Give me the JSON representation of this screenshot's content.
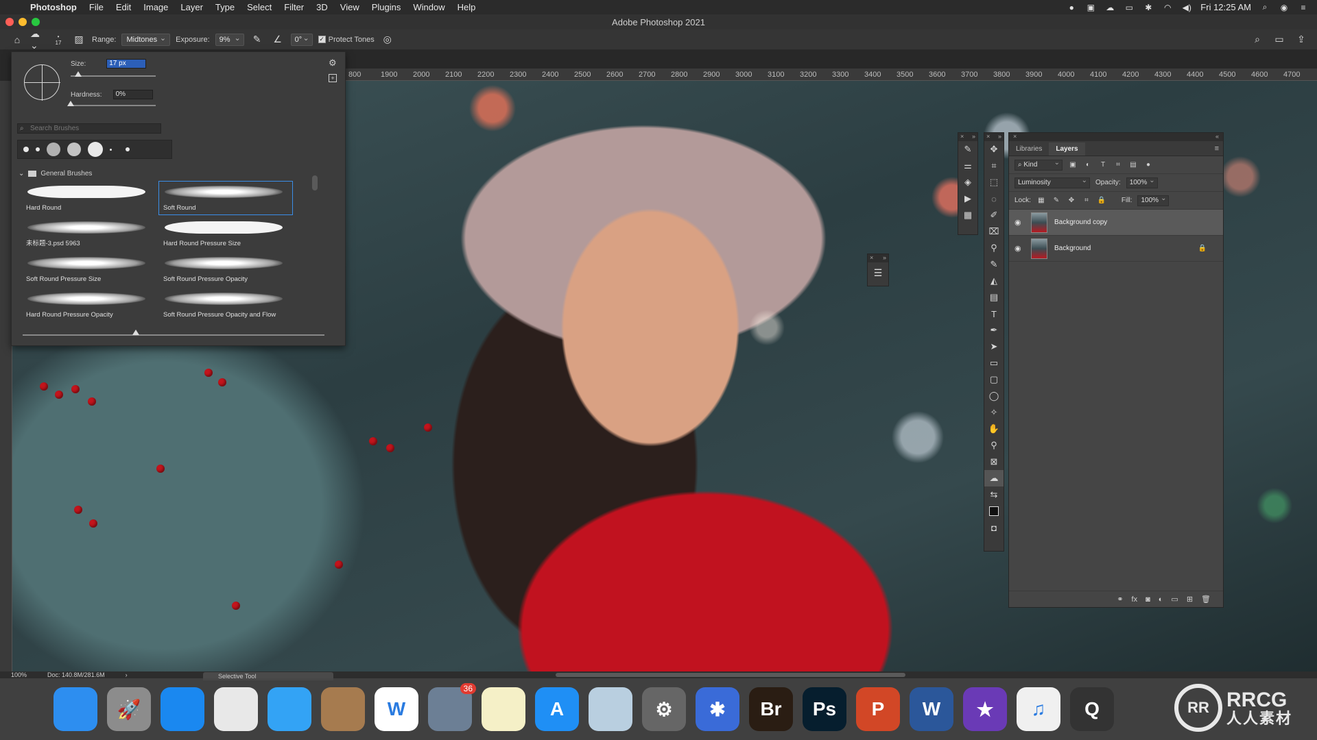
{
  "menubar": {
    "app_name": "Photoshop",
    "items": [
      "File",
      "Edit",
      "Image",
      "Layer",
      "Type",
      "Select",
      "Filter",
      "3D",
      "View",
      "Plugins",
      "Window",
      "Help"
    ],
    "clock": "Fri 12:25 AM"
  },
  "window": {
    "title": "Adobe Photoshop 2021"
  },
  "options": {
    "brush_size_indicator": "17",
    "range_label": "Range:",
    "range_value": "Midtones",
    "exposure_label": "Exposure:",
    "exposure_value": "9%",
    "angle_value": "0°",
    "protect_tones_label": "Protect Tones",
    "protect_tones_checked": true
  },
  "ruler": {
    "ticks": [
      "800",
      "1900",
      "2000",
      "2100",
      "2200",
      "2300",
      "2400",
      "2500",
      "2600",
      "2700",
      "2800",
      "2900",
      "3000",
      "3100",
      "3200",
      "3300",
      "3400",
      "3500",
      "3600",
      "3700",
      "3800",
      "3900",
      "4000",
      "4100",
      "4200",
      "4300",
      "4400",
      "4500",
      "4600",
      "4700"
    ]
  },
  "brush_panel": {
    "size_label": "Size:",
    "size_value": "17 px",
    "hardness_label": "Hardness:",
    "hardness_value": "0%",
    "search_placeholder": "Search Brushes",
    "folder_name": "General Brushes",
    "brushes": [
      {
        "name": "Hard Round",
        "style": "hard"
      },
      {
        "name": "Soft Round",
        "style": "soft"
      },
      {
        "name": "未标题-3.psd 5963",
        "style": "soft"
      },
      {
        "name": "Hard Round Pressure Size",
        "style": "hard"
      },
      {
        "name": "Soft Round Pressure Size",
        "style": "soft"
      },
      {
        "name": "Soft Round Pressure Opacity",
        "style": "soft"
      },
      {
        "name": "Hard Round Pressure Opacity",
        "style": "soft"
      },
      {
        "name": "Soft Round Pressure Opacity and Flow",
        "style": "soft"
      }
    ],
    "selected_brush": "Soft Round"
  },
  "layers_panel": {
    "tabs": [
      "Libraries",
      "Layers"
    ],
    "active_tab": "Layers",
    "filter_kind": "Kind",
    "blend_mode": "Luminosity",
    "opacity_label": "Opacity:",
    "opacity_value": "100%",
    "lock_label": "Lock:",
    "fill_label": "Fill:",
    "fill_value": "100%",
    "layers": [
      {
        "name": "Background copy",
        "active": true,
        "locked": false
      },
      {
        "name": "Background",
        "active": false,
        "locked": true
      }
    ]
  },
  "status": {
    "zoom": "100%",
    "doc_size": "Doc: 140.8M/281.6M",
    "doc_tab": "Selective Tool"
  },
  "dock": {
    "apps": [
      {
        "name": "Finder",
        "label": "",
        "color": "#2d8ef0"
      },
      {
        "name": "Launchpad",
        "label": "🚀",
        "color": "#8c8c8c"
      },
      {
        "name": "Safari",
        "label": "",
        "color": "#1a88f0"
      },
      {
        "name": "Chrome",
        "label": "",
        "color": "#e8e8e8"
      },
      {
        "name": "Messages",
        "label": "",
        "color": "#33a3f5"
      },
      {
        "name": "Contacts",
        "label": "",
        "color": "#a67b4f"
      },
      {
        "name": "Word Tool",
        "label": "W",
        "color": "#ffffff"
      },
      {
        "name": "Mail Eagle",
        "label": "",
        "color": "#6c7f95",
        "badge": "36"
      },
      {
        "name": "Notes",
        "label": "",
        "color": "#f5f0c7"
      },
      {
        "name": "App Store",
        "label": "A",
        "color": "#1f8ff5"
      },
      {
        "name": "Preview",
        "label": "",
        "color": "#b9cfe0"
      },
      {
        "name": "System Preferences",
        "label": "⚙",
        "color": "#666666"
      },
      {
        "name": "Bluetooth",
        "label": "✱",
        "color": "#3a6bd8"
      },
      {
        "name": "Bridge",
        "label": "Br",
        "color": "#2a1d13"
      },
      {
        "name": "Photoshop",
        "label": "Ps",
        "color": "#061e2e"
      },
      {
        "name": "PowerPoint",
        "label": "P",
        "color": "#d24726"
      },
      {
        "name": "Word",
        "label": "W",
        "color": "#2b579a"
      },
      {
        "name": "iMovie",
        "label": "★",
        "color": "#6a3ab6"
      },
      {
        "name": "Music",
        "label": "♫",
        "color": "#f0f0f0"
      },
      {
        "name": "QuickTime",
        "label": "Q",
        "color": "#333"
      }
    ]
  },
  "watermark": {
    "text_top": "RRCG",
    "text_bottom": "人人素材"
  }
}
